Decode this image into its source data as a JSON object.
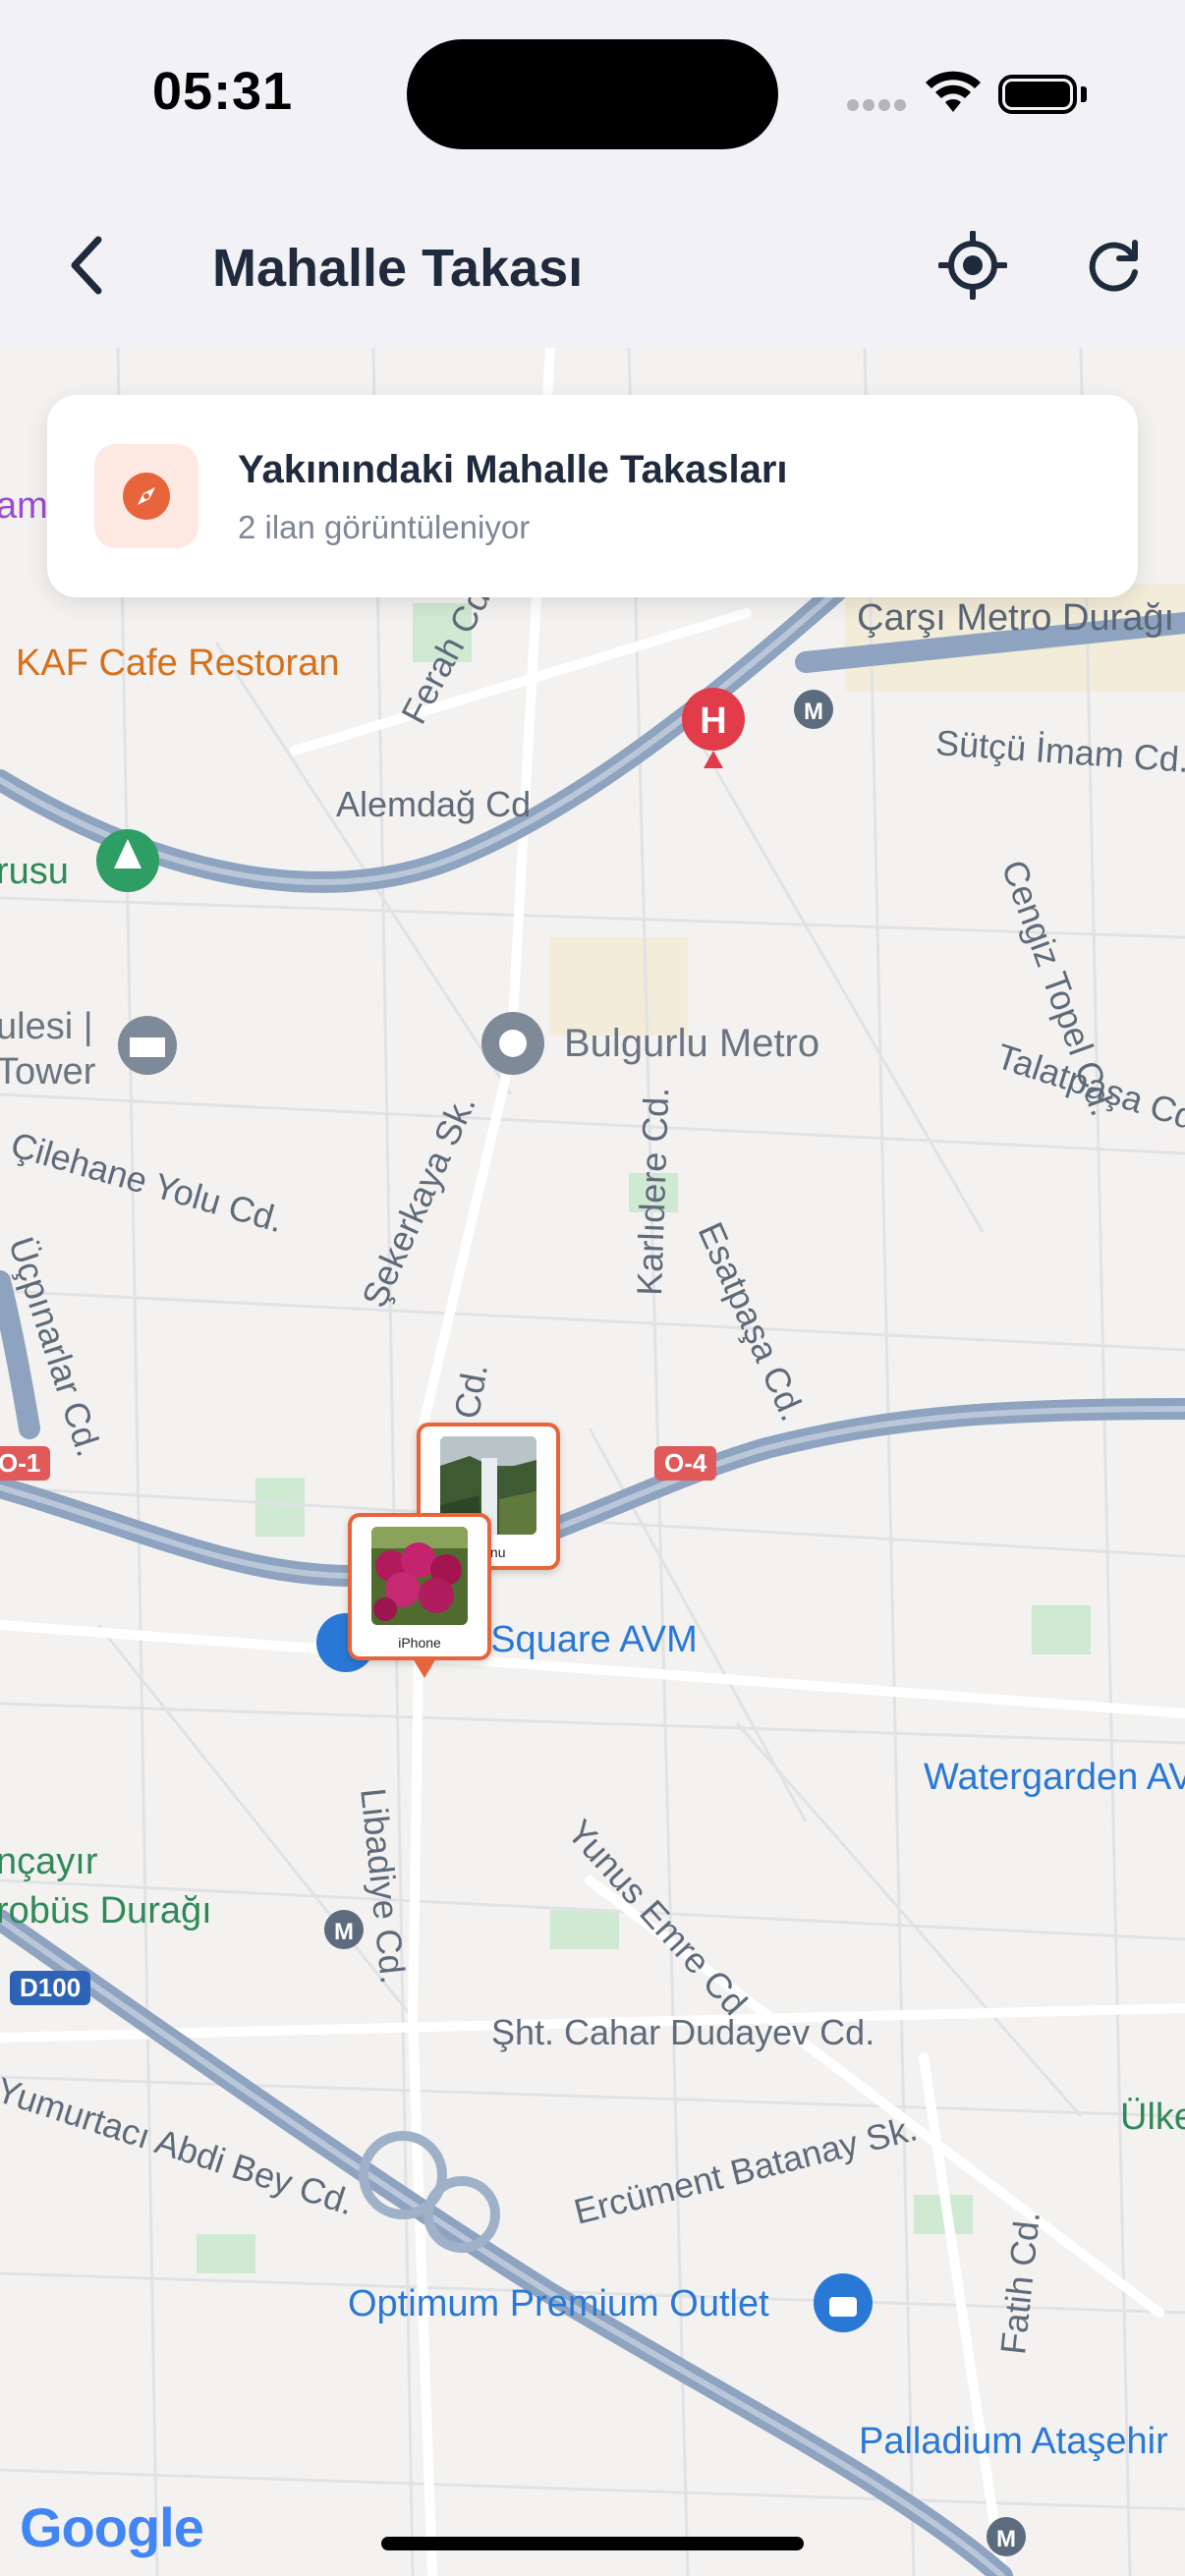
{
  "status": {
    "time": "05:31"
  },
  "nav": {
    "title": "Mahalle Takası"
  },
  "card": {
    "title": "Yakınındaki Mahalle Takasları",
    "subtitle": "2 ilan görüntüleniyor"
  },
  "listings": [
    {
      "caption": "iPhone"
    },
    {
      "caption": "efonu"
    }
  ],
  "map_labels": {
    "kaf_cafe": "KAF Cafe Restoran",
    "carsi_metro": "Çarşı Metro Durağı",
    "ferah": "Ferah Cd.",
    "alemdag": "Alemdağ Cd",
    "sutcu": "Sütçü İmam Cd.",
    "cengiz": "Cengiz Topel Cd.",
    "talatpasa": "Talatpaşa Cd",
    "bulgurlu": "Bulgurlu Metro",
    "rusu": "rusu",
    "ulesi": "ulesi |",
    "tower": "Tower",
    "cilehane": "Çilehane Yolu Cd.",
    "sekerkaya": "Şekerkaya Sk.",
    "karlidere": "Karlıdere Cd.",
    "esatpasa": "Esatpaşa Cd.",
    "ucpinarlar": "Üçpınarlar Cd.",
    "cd": "Cd.",
    "square": "r Square AVM",
    "libadiye": "Libadiye Cd.",
    "yunus": "Yunus Emre Cd",
    "watergarden": "Watergarden AV",
    "ncayir": "nçayır",
    "robus": "robüs Durağı",
    "cahar": "Şht. Cahar Dudayev Cd.",
    "yumurtaci": "Yumurtacı Abdi Bey Cd.",
    "ercument": "Ercüment Batanay Sk.",
    "ulke": "Ülke",
    "optimum": "Optimum Premium Outlet",
    "fatih": "Fatih Cd.",
    "palladium": "Palladium Ataşehir",
    "aml": "aml",
    "shield_o4": "O-4",
    "shield_o1": "O-1",
    "shield_d100": "D100",
    "google": "Google"
  },
  "colors": {
    "accent": "#e8643a",
    "title": "#1f2a3d",
    "poi_blue": "#2a78d6",
    "poi_orange": "#d7701b"
  }
}
